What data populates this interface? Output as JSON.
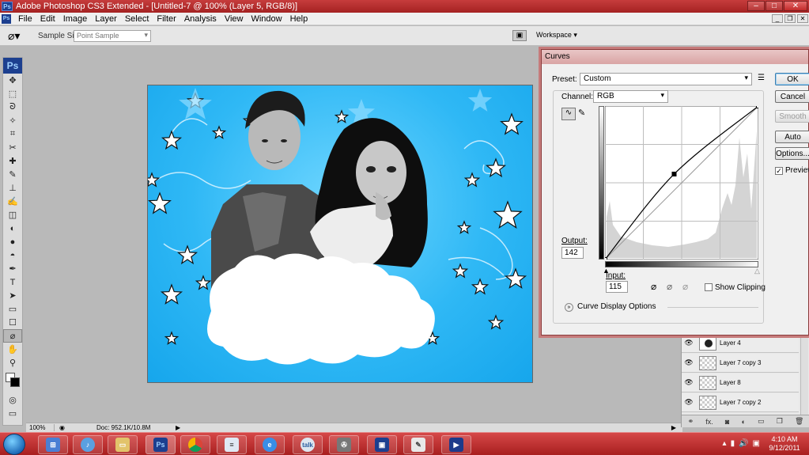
{
  "window": {
    "title": "Adobe Photoshop CS3 Extended - [Untitled-7 @ 100% (Layer 5, RGB/8)]",
    "ps_mark": "Ps"
  },
  "menu": [
    "File",
    "Edit",
    "Image",
    "Layer",
    "Select",
    "Filter",
    "Analysis",
    "View",
    "Window",
    "Help"
  ],
  "options_bar": {
    "sample_size_label": "Sample Size:",
    "sample_size_value": "Point Sample",
    "workspace_label": "Workspace ▾"
  },
  "tools": {
    "logo": "Ps",
    "items": [
      "move-icon",
      "marquee-icon",
      "lasso-icon",
      "magic-wand-icon",
      "crop-icon",
      "slice-icon",
      "healing-icon",
      "brush-icon",
      "stamp-icon",
      "history-brush-icon",
      "eraser-icon",
      "bucket-icon",
      "blur-icon",
      "dodge-icon",
      "pen-icon",
      "type-icon",
      "path-select-icon",
      "shape-icon",
      "notes-icon",
      "eyedropper-icon",
      "hand-icon",
      "zoom-icon"
    ],
    "glyphs": [
      "✥",
      "⬚",
      "ᘐ",
      "✧",
      "⌗",
      "✂",
      "✚",
      "✎",
      "⊥",
      "✍",
      "◫",
      "◐",
      "●",
      "◓",
      "✒",
      "T",
      "➤",
      "▭",
      "☐",
      "⌀",
      "✋",
      "⚲"
    ],
    "active_index": 19
  },
  "status_bar": {
    "zoom": "100%",
    "doc": "Doc: 952.1K/10.8M"
  },
  "curves": {
    "title": "Curves",
    "preset_label": "Preset:",
    "preset_value": "Custom",
    "channel_label": "Channel:",
    "channel_value": "RGB",
    "output_label": "Output:",
    "output_value": "142",
    "input_label": "Input:",
    "input_value": "115",
    "show_clipping_label": "Show Clipping",
    "curve_display_options_label": "Curve Display Options",
    "buttons": {
      "ok": "OK",
      "cancel": "Cancel",
      "smooth": "Smooth",
      "auto": "Auto",
      "options": "Options...",
      "preview": "Preview"
    },
    "preview_checked": true,
    "curve_points": [
      [
        0,
        0
      ],
      [
        115,
        142
      ],
      [
        255,
        255
      ]
    ]
  },
  "layers": [
    {
      "name": "Layer 4"
    },
    {
      "name": "Layer 7 copy 3"
    },
    {
      "name": "Layer 8"
    },
    {
      "name": "Layer 7 copy 2"
    }
  ],
  "taskbar": {
    "time": "4:10 AM",
    "date": "9/12/2011",
    "photoshop_label": "Ps",
    "talk_label": "talk"
  },
  "colors": {
    "accent": "#b02a2a",
    "canvas_blue": "#2fb8f5"
  }
}
